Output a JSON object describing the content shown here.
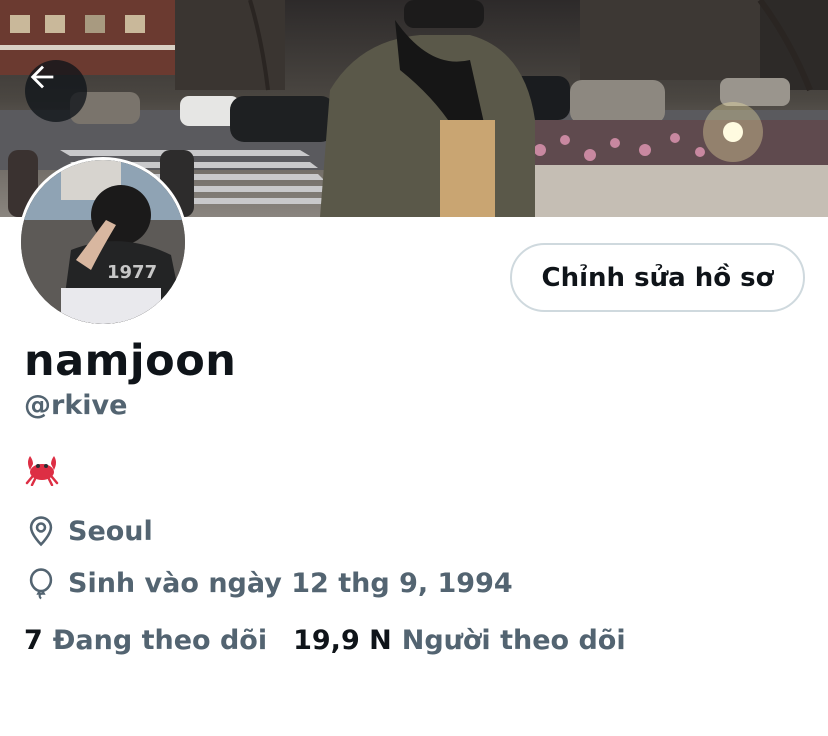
{
  "header": {
    "back_icon": "arrow-left-icon"
  },
  "profile": {
    "display_name": "namjoon",
    "handle": "@rkive",
    "bio_emoji": "crab-icon",
    "edit_button_label": "Chỉnh sửa hồ sơ",
    "location": "Seoul",
    "location_icon": "location-pin-icon",
    "birthday": "Sinh vào ngày 12 thg 9, 1994",
    "birthday_icon": "balloon-icon"
  },
  "stats": {
    "following_count": "7",
    "following_label": "Đang theo dõi",
    "followers_count": "19,9 N",
    "followers_label": "Người theo dõi"
  },
  "colors": {
    "primary_text": "#0f1419",
    "secondary_text": "#536471",
    "button_border": "#cfd9de"
  }
}
